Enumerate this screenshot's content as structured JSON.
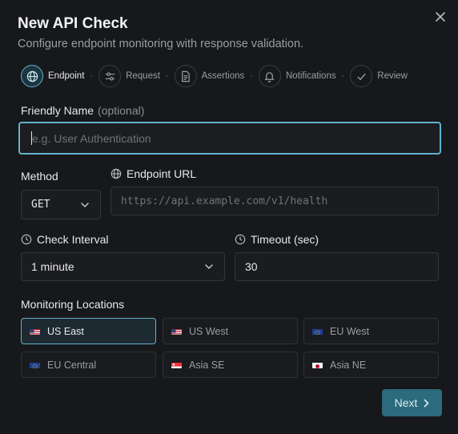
{
  "dialog": {
    "title": "New API Check",
    "subtitle": "Configure endpoint monitoring with response validation."
  },
  "steps": [
    {
      "label": "Endpoint",
      "icon": "globe-icon",
      "active": true
    },
    {
      "label": "Request",
      "icon": "sliders-icon",
      "active": false
    },
    {
      "label": "Assertions",
      "icon": "document-icon",
      "active": false
    },
    {
      "label": "Notifications",
      "icon": "bell-icon",
      "active": false
    },
    {
      "label": "Review",
      "icon": "check-icon",
      "active": false
    }
  ],
  "step_separator": "-",
  "form": {
    "friendly_name": {
      "label": "Friendly Name",
      "optional": "(optional)",
      "placeholder": "e.g. User Authentication",
      "value": ""
    },
    "method": {
      "label": "Method",
      "value": "GET"
    },
    "endpoint_url": {
      "label": "Endpoint URL",
      "placeholder": "https://api.example.com/v1/health",
      "value": ""
    },
    "check_interval": {
      "label": "Check Interval",
      "value": "1 minute"
    },
    "timeout": {
      "label": "Timeout (sec)",
      "value": "30"
    }
  },
  "locations": {
    "label": "Monitoring Locations",
    "items": [
      {
        "label": "US East",
        "flag": "us",
        "selected": true
      },
      {
        "label": "US West",
        "flag": "us",
        "selected": false
      },
      {
        "label": "EU West",
        "flag": "eu",
        "selected": false
      },
      {
        "label": "EU Central",
        "flag": "eu",
        "selected": false
      },
      {
        "label": "Asia SE",
        "flag": "sg",
        "selected": false
      },
      {
        "label": "Asia NE",
        "flag": "jp",
        "selected": false
      }
    ]
  },
  "footer": {
    "next_label": "Next"
  },
  "colors": {
    "accent": "#5fb2cc",
    "primary_button": "#2c6a7e",
    "background": "#17181b"
  }
}
